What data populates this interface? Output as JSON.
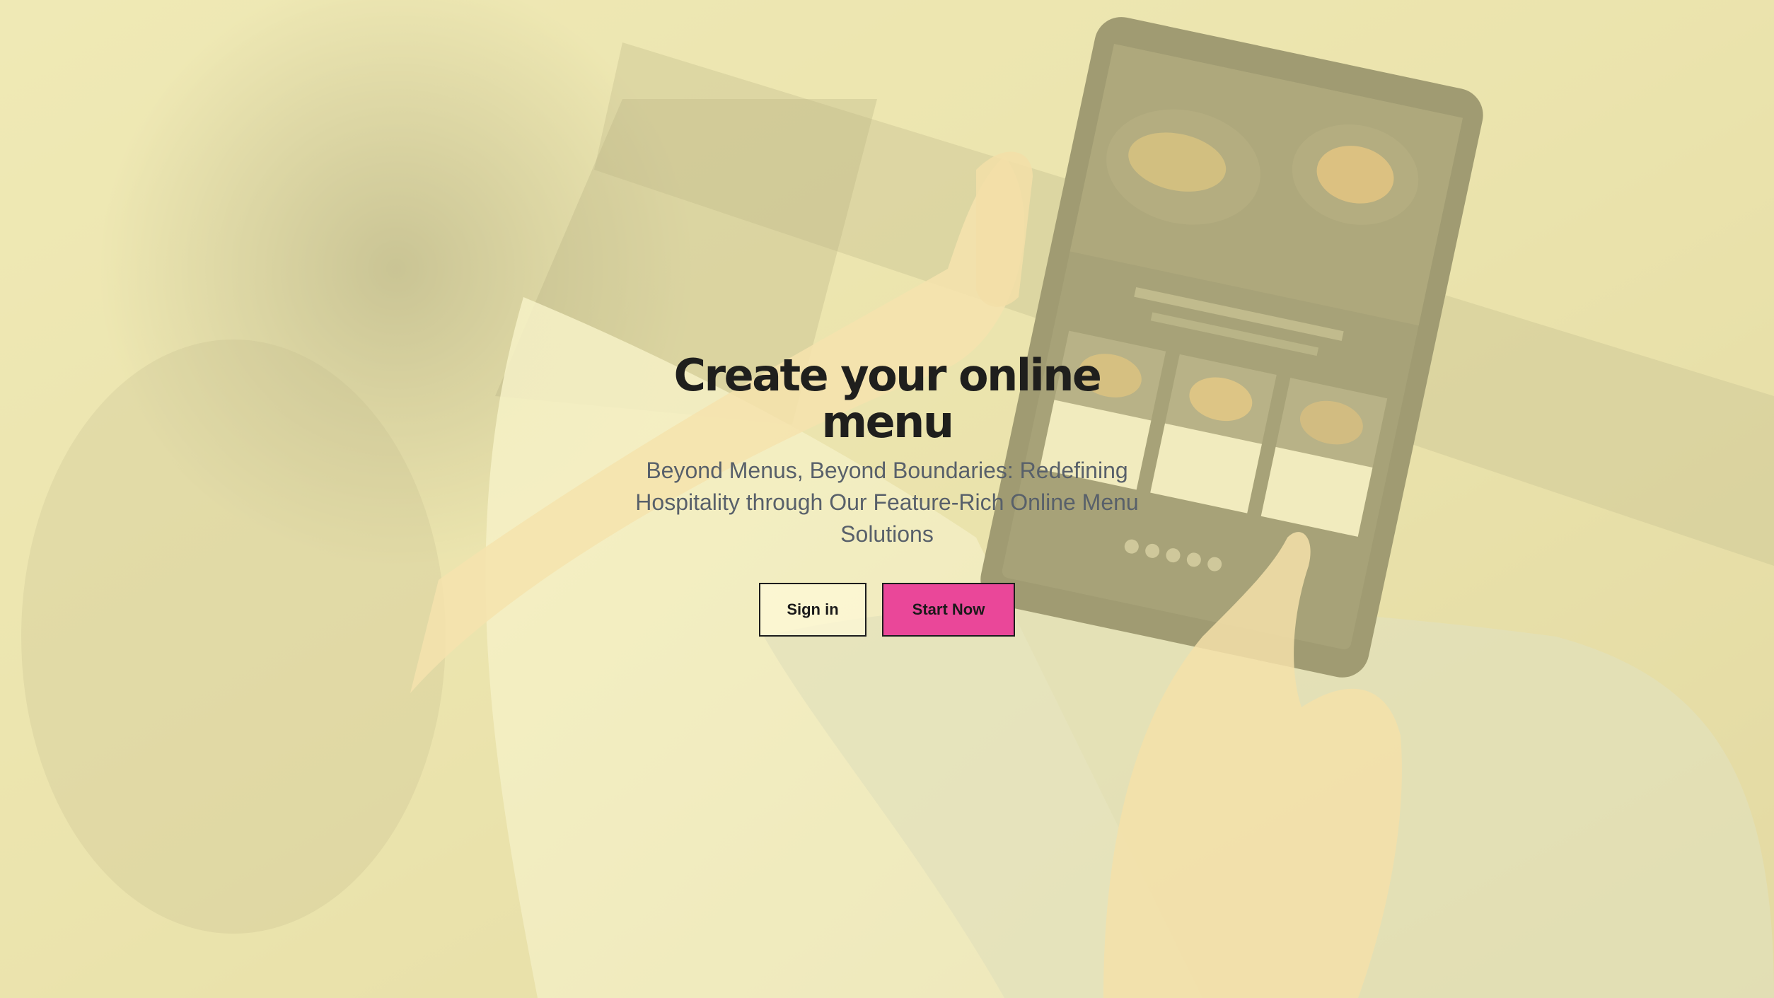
{
  "hero": {
    "background_image": "woman-holding-tablet-showing-online-menu",
    "overlay_color": "#fff8b4",
    "headline": "Create your online menu",
    "subtitle": "Beyond Menus, Beyond Boundaries: Redefining Hospitality through Our Feature-Rich Online Menu Solutions",
    "buttons": {
      "sign_in_label": "Sign in",
      "start_now_label": "Start Now"
    }
  },
  "colors": {
    "background": "#f3ecb4",
    "accent": "#ea4799",
    "headline_text": "#1f1f1d",
    "subtitle_text": "#58606a"
  }
}
